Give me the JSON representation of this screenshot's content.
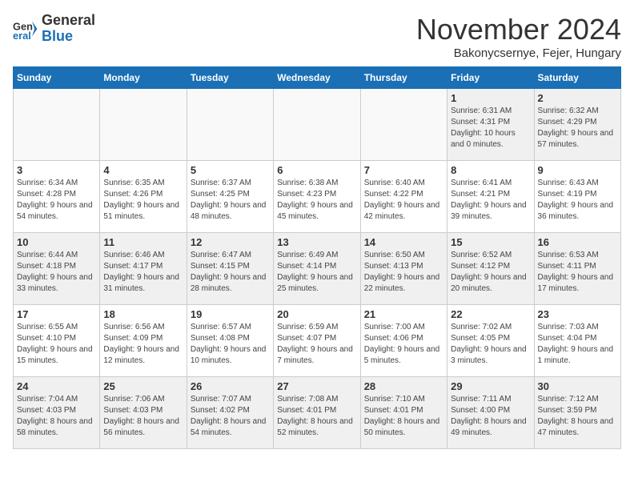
{
  "header": {
    "logo_line1": "General",
    "logo_line2": "Blue",
    "month": "November 2024",
    "location": "Bakonycsernye, Fejer, Hungary"
  },
  "days_of_week": [
    "Sunday",
    "Monday",
    "Tuesday",
    "Wednesday",
    "Thursday",
    "Friday",
    "Saturday"
  ],
  "weeks": [
    [
      {
        "day": "",
        "info": "",
        "empty": true
      },
      {
        "day": "",
        "info": "",
        "empty": true
      },
      {
        "day": "",
        "info": "",
        "empty": true
      },
      {
        "day": "",
        "info": "",
        "empty": true
      },
      {
        "day": "",
        "info": "",
        "empty": true
      },
      {
        "day": "1",
        "info": "Sunrise: 6:31 AM\nSunset: 4:31 PM\nDaylight: 10 hours and 0 minutes."
      },
      {
        "day": "2",
        "info": "Sunrise: 6:32 AM\nSunset: 4:29 PM\nDaylight: 9 hours and 57 minutes."
      }
    ],
    [
      {
        "day": "3",
        "info": "Sunrise: 6:34 AM\nSunset: 4:28 PM\nDaylight: 9 hours and 54 minutes."
      },
      {
        "day": "4",
        "info": "Sunrise: 6:35 AM\nSunset: 4:26 PM\nDaylight: 9 hours and 51 minutes."
      },
      {
        "day": "5",
        "info": "Sunrise: 6:37 AM\nSunset: 4:25 PM\nDaylight: 9 hours and 48 minutes."
      },
      {
        "day": "6",
        "info": "Sunrise: 6:38 AM\nSunset: 4:23 PM\nDaylight: 9 hours and 45 minutes."
      },
      {
        "day": "7",
        "info": "Sunrise: 6:40 AM\nSunset: 4:22 PM\nDaylight: 9 hours and 42 minutes."
      },
      {
        "day": "8",
        "info": "Sunrise: 6:41 AM\nSunset: 4:21 PM\nDaylight: 9 hours and 39 minutes."
      },
      {
        "day": "9",
        "info": "Sunrise: 6:43 AM\nSunset: 4:19 PM\nDaylight: 9 hours and 36 minutes."
      }
    ],
    [
      {
        "day": "10",
        "info": "Sunrise: 6:44 AM\nSunset: 4:18 PM\nDaylight: 9 hours and 33 minutes."
      },
      {
        "day": "11",
        "info": "Sunrise: 6:46 AM\nSunset: 4:17 PM\nDaylight: 9 hours and 31 minutes."
      },
      {
        "day": "12",
        "info": "Sunrise: 6:47 AM\nSunset: 4:15 PM\nDaylight: 9 hours and 28 minutes."
      },
      {
        "day": "13",
        "info": "Sunrise: 6:49 AM\nSunset: 4:14 PM\nDaylight: 9 hours and 25 minutes."
      },
      {
        "day": "14",
        "info": "Sunrise: 6:50 AM\nSunset: 4:13 PM\nDaylight: 9 hours and 22 minutes."
      },
      {
        "day": "15",
        "info": "Sunrise: 6:52 AM\nSunset: 4:12 PM\nDaylight: 9 hours and 20 minutes."
      },
      {
        "day": "16",
        "info": "Sunrise: 6:53 AM\nSunset: 4:11 PM\nDaylight: 9 hours and 17 minutes."
      }
    ],
    [
      {
        "day": "17",
        "info": "Sunrise: 6:55 AM\nSunset: 4:10 PM\nDaylight: 9 hours and 15 minutes."
      },
      {
        "day": "18",
        "info": "Sunrise: 6:56 AM\nSunset: 4:09 PM\nDaylight: 9 hours and 12 minutes."
      },
      {
        "day": "19",
        "info": "Sunrise: 6:57 AM\nSunset: 4:08 PM\nDaylight: 9 hours and 10 minutes."
      },
      {
        "day": "20",
        "info": "Sunrise: 6:59 AM\nSunset: 4:07 PM\nDaylight: 9 hours and 7 minutes."
      },
      {
        "day": "21",
        "info": "Sunrise: 7:00 AM\nSunset: 4:06 PM\nDaylight: 9 hours and 5 minutes."
      },
      {
        "day": "22",
        "info": "Sunrise: 7:02 AM\nSunset: 4:05 PM\nDaylight: 9 hours and 3 minutes."
      },
      {
        "day": "23",
        "info": "Sunrise: 7:03 AM\nSunset: 4:04 PM\nDaylight: 9 hours and 1 minute."
      }
    ],
    [
      {
        "day": "24",
        "info": "Sunrise: 7:04 AM\nSunset: 4:03 PM\nDaylight: 8 hours and 58 minutes."
      },
      {
        "day": "25",
        "info": "Sunrise: 7:06 AM\nSunset: 4:03 PM\nDaylight: 8 hours and 56 minutes."
      },
      {
        "day": "26",
        "info": "Sunrise: 7:07 AM\nSunset: 4:02 PM\nDaylight: 8 hours and 54 minutes."
      },
      {
        "day": "27",
        "info": "Sunrise: 7:08 AM\nSunset: 4:01 PM\nDaylight: 8 hours and 52 minutes."
      },
      {
        "day": "28",
        "info": "Sunrise: 7:10 AM\nSunset: 4:01 PM\nDaylight: 8 hours and 50 minutes."
      },
      {
        "day": "29",
        "info": "Sunrise: 7:11 AM\nSunset: 4:00 PM\nDaylight: 8 hours and 49 minutes."
      },
      {
        "day": "30",
        "info": "Sunrise: 7:12 AM\nSunset: 3:59 PM\nDaylight: 8 hours and 47 minutes."
      }
    ]
  ]
}
